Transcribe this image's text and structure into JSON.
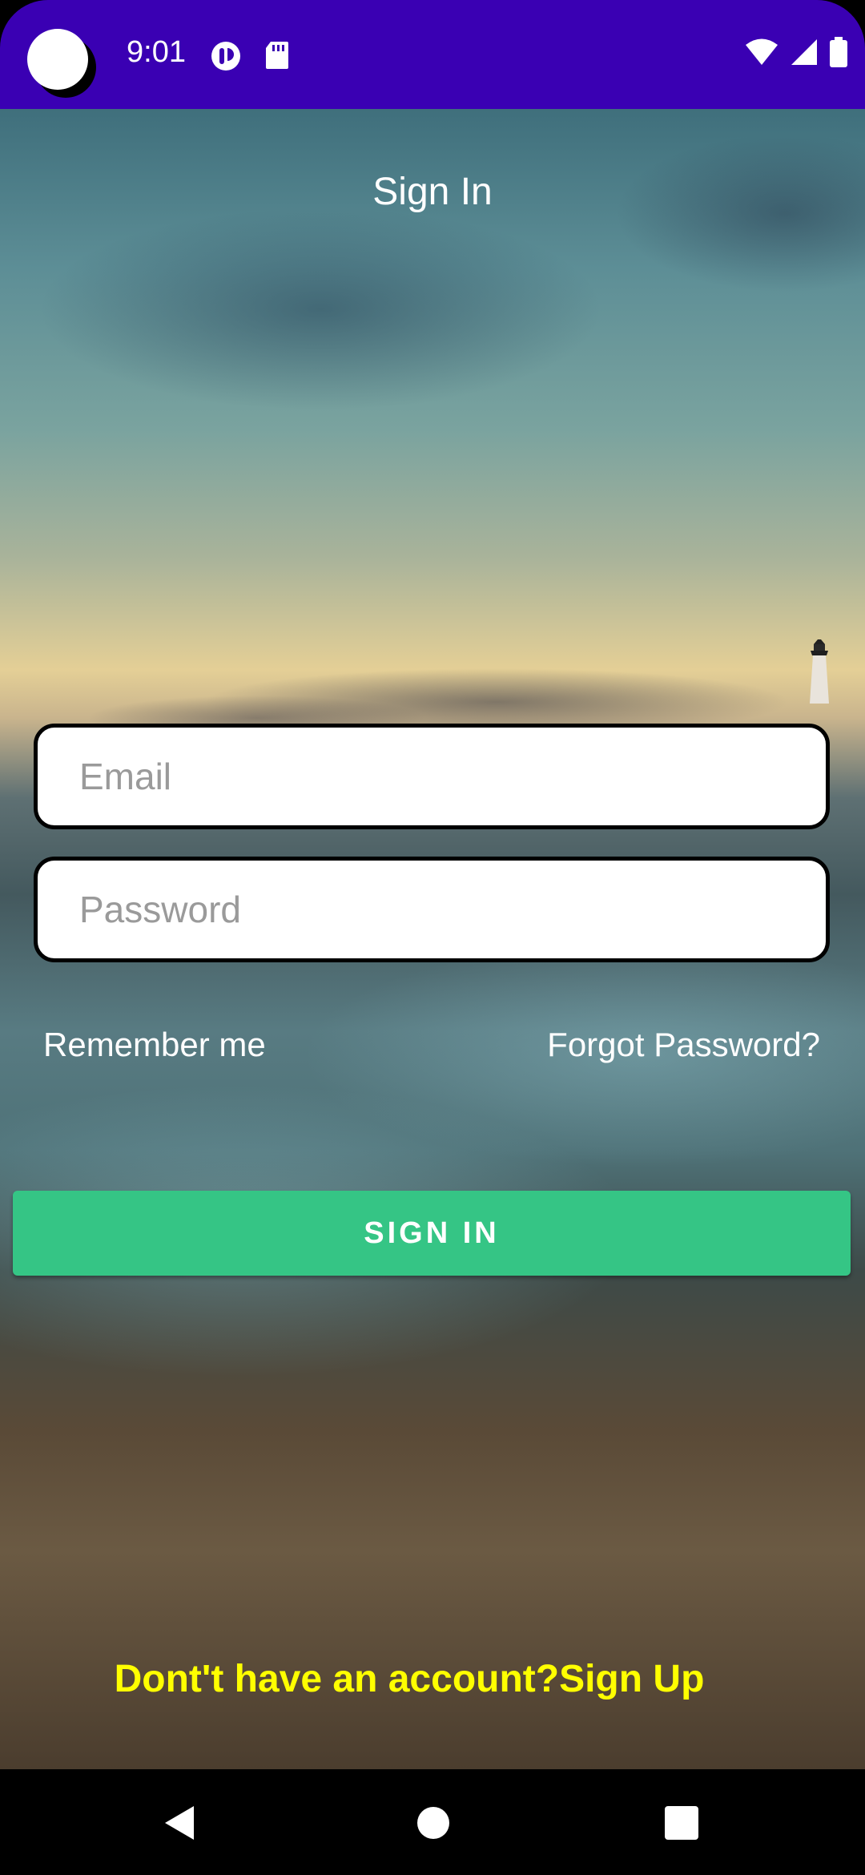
{
  "status_bar": {
    "time": "9:01",
    "left_icons": [
      "media-icon",
      "sd-card-icon"
    ],
    "right_icons": [
      "wifi-icon",
      "signal-icon",
      "battery-icon"
    ],
    "color": "#3a00b3"
  },
  "screen": {
    "title": "Sign In",
    "email": {
      "placeholder": "Email",
      "value": ""
    },
    "password": {
      "placeholder": "Password",
      "value": ""
    },
    "remember_label": "Remember me",
    "forgot_label": "Forgot Password?",
    "signin_label": "SIGN IN",
    "signup_prompt": "Dont't have an account?Sign Up"
  },
  "colors": {
    "accent": "#35c585",
    "signup_text": "#ffff00"
  },
  "nav_bar": {
    "icons": [
      "back-icon",
      "home-icon",
      "recents-icon"
    ]
  }
}
